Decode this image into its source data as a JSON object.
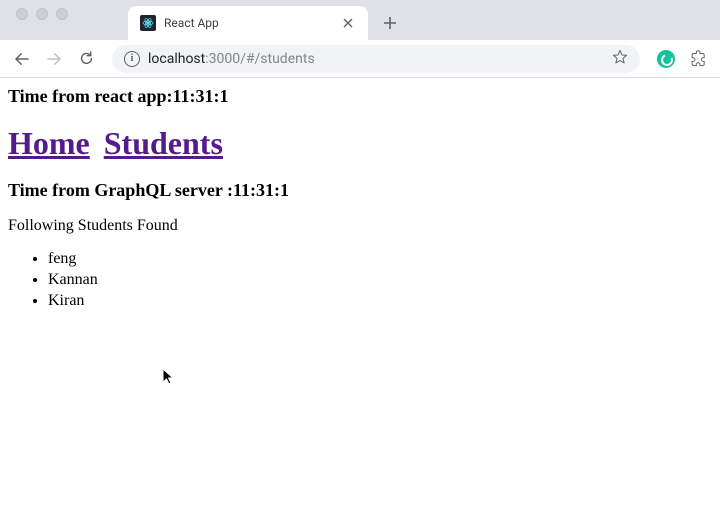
{
  "browser": {
    "tab_title": "React App",
    "url_host": "localhost",
    "url_port_path": ":3000/#/students"
  },
  "page": {
    "time_react_label": "Time from react app:",
    "time_react_value": "11:31:1",
    "nav": {
      "home": "Home",
      "students": "Students"
    },
    "time_graphql_label": "Time from GraphQL server :",
    "time_graphql_value": "11:31:1",
    "found_text": "Following Students Found",
    "students": [
      "feng",
      "Kannan",
      "Kiran"
    ]
  }
}
